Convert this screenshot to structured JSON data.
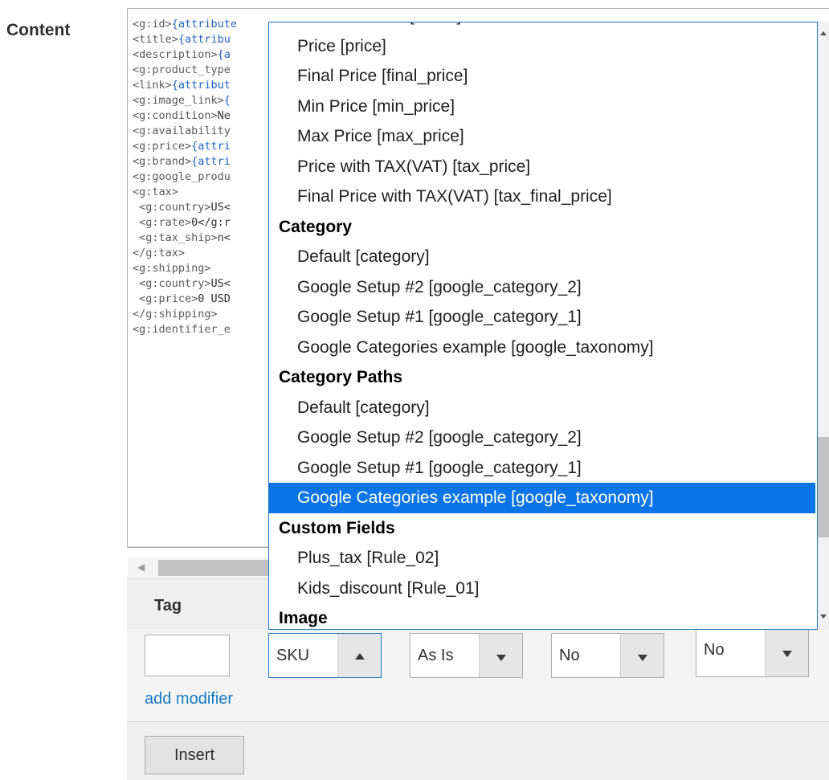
{
  "form": {
    "content_label": "Content"
  },
  "editor": {
    "lines": [
      [
        {
          "t": "<g:id>",
          "c": "tag"
        },
        {
          "t": "{attribute",
          "c": "val"
        }
      ],
      [
        {
          "t": "<title>",
          "c": "tag"
        },
        {
          "t": "{attribu",
          "c": "val"
        }
      ],
      [
        {
          "t": "<description>",
          "c": "tag"
        },
        {
          "t": "{a",
          "c": "val"
        }
      ],
      [
        {
          "t": "<g:product_type",
          "c": "tag"
        }
      ],
      [
        {
          "t": "<link>",
          "c": "tag"
        },
        {
          "t": "{attribut",
          "c": "val"
        }
      ],
      [
        {
          "t": "<g:image_link>",
          "c": "tag"
        },
        {
          "t": "{",
          "c": "val"
        }
      ],
      [
        {
          "t": "<g:condition>",
          "c": "tag"
        },
        {
          "t": "Ne",
          "c": "txt"
        }
      ],
      [
        {
          "t": "<g:availability",
          "c": "tag"
        }
      ],
      [
        {
          "t": "<g:price>",
          "c": "tag"
        },
        {
          "t": "{attri",
          "c": "val"
        }
      ],
      [
        {
          "t": "<g:brand>",
          "c": "tag"
        },
        {
          "t": "{attri",
          "c": "val"
        }
      ],
      [
        {
          "t": "<g:google_produ",
          "c": "tag"
        }
      ],
      [
        {
          "t": "<g:tax>",
          "c": "tag"
        }
      ],
      [
        {
          "t": " <g:country>",
          "c": "tag"
        },
        {
          "t": "US<",
          "c": "txt"
        }
      ],
      [
        {
          "t": " <g:rate>",
          "c": "tag"
        },
        {
          "t": "0</g:r",
          "c": "txt"
        }
      ],
      [
        {
          "t": " <g:tax_ship>",
          "c": "tag"
        },
        {
          "t": "n<",
          "c": "txt"
        }
      ],
      [
        {
          "t": "</g:tax>",
          "c": "tag"
        }
      ],
      [
        {
          "t": "<g:shipping>",
          "c": "tag"
        }
      ],
      [
        {
          "t": " <g:country>",
          "c": "tag"
        },
        {
          "t": "US<",
          "c": "txt"
        }
      ],
      [
        {
          "t": " <g:price>",
          "c": "tag"
        },
        {
          "t": "0 USD",
          "c": "txt"
        }
      ],
      [
        {
          "t": "</g:shipping>",
          "c": "tag"
        }
      ],
      [
        {
          "t": "<g:identifier_e",
          "c": "tag"
        }
      ]
    ]
  },
  "attribute_dropdown": {
    "items": [
      {
        "kind": "option",
        "label": "Product Name [name]"
      },
      {
        "kind": "option",
        "label": "Price [price]"
      },
      {
        "kind": "option",
        "label": "Final Price [final_price]"
      },
      {
        "kind": "option",
        "label": "Min Price [min_price]"
      },
      {
        "kind": "option",
        "label": "Max Price [max_price]"
      },
      {
        "kind": "option",
        "label": "Price with TAX(VAT) [tax_price]"
      },
      {
        "kind": "option",
        "label": "Final Price with TAX(VAT) [tax_final_price]"
      },
      {
        "kind": "group",
        "label": "Category"
      },
      {
        "kind": "option",
        "label": "Default [category]"
      },
      {
        "kind": "option",
        "label": "Google Setup #2 [google_category_2]"
      },
      {
        "kind": "option",
        "label": "Google Setup #1 [google_category_1]"
      },
      {
        "kind": "option",
        "label": "Google Categories example [google_taxonomy]"
      },
      {
        "kind": "group",
        "label": "Category Paths"
      },
      {
        "kind": "option",
        "label": "Default [category]"
      },
      {
        "kind": "option",
        "label": "Google Setup #2 [google_category_2]"
      },
      {
        "kind": "option",
        "label": "Google Setup #1 [google_category_1]"
      },
      {
        "kind": "option",
        "label": "Google Categories example [google_taxonomy]",
        "selected": true
      },
      {
        "kind": "group",
        "label": "Custom Fields"
      },
      {
        "kind": "option",
        "label": "Plus_tax [Rule_02]"
      },
      {
        "kind": "option",
        "label": "Kids_discount [Rule_01]"
      },
      {
        "kind": "group",
        "label": "Image"
      }
    ]
  },
  "tag_section": {
    "header_label": "Tag",
    "tag_name_value": "",
    "attribute_select_value": "SKU",
    "format_select_value": "As Is",
    "parent_select_value": "No",
    "optional_select_value": "No",
    "add_modifier_label": "add modifier",
    "insert_label": "Insert"
  }
}
